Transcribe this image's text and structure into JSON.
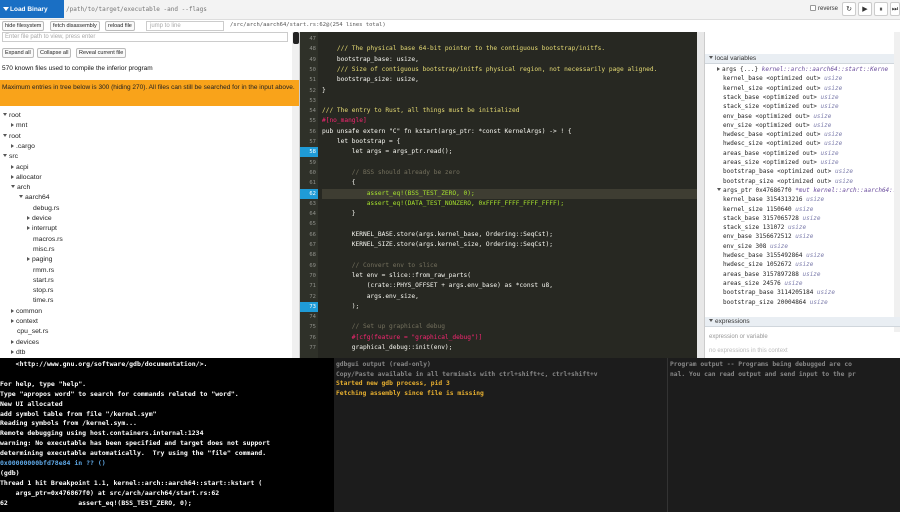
{
  "toolbar": {
    "load_label": "Load Binary",
    "binary_placeholder": "/path/to/target/executable -and --flags",
    "reverse_label": "reverse",
    "controls": [
      "↻",
      "▶",
      "⏸",
      "⏭"
    ]
  },
  "secondbar": {
    "hide_fs": "hide filesystem",
    "fetch_disasm": "fetch disassembly",
    "reload": "reload file",
    "jump_placeholder": "jump to line",
    "file_path": "/src/arch/aarch64/start.rs:62@(254 lines total)"
  },
  "left": {
    "filter_placeholder": "Enter file path to view, press enter",
    "expand_all": "Expand all",
    "collapse_all": "Collapse all",
    "reveal_current": "Reveal current file",
    "known_files": "570 known files used to compile the inferior program",
    "warning": "Maximum entries in tree below is 300 (hiding 270). All files can still be searched for in the input above.",
    "tree": [
      {
        "label": "root",
        "depth": 0,
        "icon": "down"
      },
      {
        "label": "mnt",
        "depth": 1,
        "icon": "right"
      },
      {
        "label": "root",
        "depth": 0,
        "icon": "down"
      },
      {
        "label": ".cargo",
        "depth": 1,
        "icon": "right"
      },
      {
        "label": "src",
        "depth": 0,
        "icon": "down"
      },
      {
        "label": "acpi",
        "depth": 1,
        "icon": "right"
      },
      {
        "label": "allocator",
        "depth": 1,
        "icon": "right"
      },
      {
        "label": "arch",
        "depth": 1,
        "icon": "down"
      },
      {
        "label": "aarch64",
        "depth": 2,
        "icon": "down"
      },
      {
        "label": "debug.rs",
        "depth": 3,
        "icon": ""
      },
      {
        "label": "device",
        "depth": 3,
        "icon": "right"
      },
      {
        "label": "interrupt",
        "depth": 3,
        "icon": "right"
      },
      {
        "label": "macros.rs",
        "depth": 3,
        "icon": ""
      },
      {
        "label": "misc.rs",
        "depth": 3,
        "icon": ""
      },
      {
        "label": "paging",
        "depth": 3,
        "icon": "right"
      },
      {
        "label": "rmm.rs",
        "depth": 3,
        "icon": ""
      },
      {
        "label": "start.rs",
        "depth": 3,
        "icon": ""
      },
      {
        "label": "stop.rs",
        "depth": 3,
        "icon": ""
      },
      {
        "label": "time.rs",
        "depth": 3,
        "icon": ""
      },
      {
        "label": "common",
        "depth": 1,
        "icon": "right"
      },
      {
        "label": "context",
        "depth": 1,
        "icon": "right"
      },
      {
        "label": "cpu_set.rs",
        "depth": 1,
        "icon": ""
      },
      {
        "label": "devices",
        "depth": 1,
        "icon": "right"
      },
      {
        "label": "dtb",
        "depth": 1,
        "icon": "right"
      }
    ]
  },
  "editor": {
    "lines": [
      {
        "n": "47",
        "t": ""
      },
      {
        "n": "48",
        "t": "    /// The physical base 64-bit pointer to the contiguous bootstrap/initfs.",
        "c": "#e6db74"
      },
      {
        "n": "49",
        "t": "    bootstrap_base: usize,"
      },
      {
        "n": "50",
        "t": "    /// Size of contiguous bootstrap/initfs physical region, not necessarily page aligned.",
        "c": "#e6db74"
      },
      {
        "n": "51",
        "t": "    bootstrap_size: usize,"
      },
      {
        "n": "52",
        "t": "}"
      },
      {
        "n": "53",
        "t": ""
      },
      {
        "n": "54",
        "t": "/// The entry to Rust, all things must be initialized",
        "c": "#e6db74"
      },
      {
        "n": "55",
        "t": "#[no_mangle]",
        "c": "#f92672"
      },
      {
        "n": "56",
        "t": "pub unsafe extern \"C\" fn kstart(args_ptr: *const KernelArgs) -> ! {"
      },
      {
        "n": "57",
        "t": "    let bootstrap = {"
      },
      {
        "n": "58",
        "t": "        let args = args_ptr.read();",
        "bp": true
      },
      {
        "n": "59",
        "t": ""
      },
      {
        "n": "60",
        "t": "        // BSS should already be zero",
        "c": "#75715e"
      },
      {
        "n": "61",
        "t": "        {"
      },
      {
        "n": "62",
        "t": "            assert_eq!(BSS_TEST_ZERO, 0);",
        "bp": true,
        "cur": true,
        "c": "#a6e22e"
      },
      {
        "n": "63",
        "t": "            assert_eq!(DATA_TEST_NONZERO, 0xFFFF_FFFF_FFFF_FFFF);",
        "c": "#a6e22e"
      },
      {
        "n": "64",
        "t": "        }"
      },
      {
        "n": "65",
        "t": ""
      },
      {
        "n": "66",
        "t": "        KERNEL_BASE.store(args.kernel_base, Ordering::SeqCst);"
      },
      {
        "n": "67",
        "t": "        KERNEL_SIZE.store(args.kernel_size, Ordering::SeqCst);"
      },
      {
        "n": "68",
        "t": ""
      },
      {
        "n": "69",
        "t": "        // Convert env to slice",
        "c": "#75715e"
      },
      {
        "n": "70",
        "t": "        let env = slice::from_raw_parts("
      },
      {
        "n": "71",
        "t": "            (crate::PHYS_OFFSET + args.env_base) as *const u8,"
      },
      {
        "n": "72",
        "t": "            args.env_size,"
      },
      {
        "n": "73",
        "t": "        );",
        "bp": true
      },
      {
        "n": "74",
        "t": ""
      },
      {
        "n": "75",
        "t": "        // Set up graphical debug",
        "c": "#75715e"
      },
      {
        "n": "76",
        "t": "        #[cfg(feature = \"graphical_debug\")]",
        "c": "#f92672"
      },
      {
        "n": "77",
        "t": "        graphical_debug::init(env);"
      }
    ]
  },
  "right": {
    "locals_title": "local variables",
    "locals": [
      {
        "name": "args {...}",
        "value": " kernel::arch::aarch64::start::Kerne",
        "kind": "fn",
        "tri": "right"
      },
      {
        "name": "kernel_base <optimized out>",
        "value": " usize",
        "kind": "ty"
      },
      {
        "name": "kernel_size <optimized out>",
        "value": " usize",
        "kind": "ty"
      },
      {
        "name": "stack_base <optimized out>",
        "value": " usize",
        "kind": "ty"
      },
      {
        "name": "stack_size <optimized out>",
        "value": " usize",
        "kind": "ty"
      },
      {
        "name": "env_base <optimized out>",
        "value": " usize",
        "kind": "ty"
      },
      {
        "name": "env_size <optimized out>",
        "value": " usize",
        "kind": "ty"
      },
      {
        "name": "hwdesc_base <optimized out>",
        "value": " usize",
        "kind": "ty"
      },
      {
        "name": "hwdesc_size <optimized out>",
        "value": " usize",
        "kind": "ty"
      },
      {
        "name": "areas_base <optimized out>",
        "value": " usize",
        "kind": "ty"
      },
      {
        "name": "areas_size <optimized out>",
        "value": " usize",
        "kind": "ty"
      },
      {
        "name": "bootstrap_base <optimized out>",
        "value": " usize",
        "kind": "ty"
      },
      {
        "name": "bootstrap_size <optimized out>",
        "value": " usize",
        "kind": "ty"
      },
      {
        "name": "args_ptr 0x476867f0",
        "value": " *mut kernel::arch::aarch64::s",
        "kind": "fn",
        "tri": "down"
      },
      {
        "name": "kernel_base 3154313216",
        "value": " usize",
        "kind": "ty"
      },
      {
        "name": "kernel_size 1150640",
        "value": " usize",
        "kind": "ty"
      },
      {
        "name": "stack_base 3157065728",
        "value": " usize",
        "kind": "ty"
      },
      {
        "name": "stack_size 131072",
        "value": " usize",
        "kind": "ty"
      },
      {
        "name": "env_base 3156672512",
        "value": " usize",
        "kind": "ty"
      },
      {
        "name": "env_size 308",
        "value": " usize",
        "kind": "ty"
      },
      {
        "name": "hwdesc_base 3155492864",
        "value": " usize",
        "kind": "ty"
      },
      {
        "name": "hwdesc_size 1052672",
        "value": " usize",
        "kind": "ty"
      },
      {
        "name": "areas_base 3157897288",
        "value": " usize",
        "kind": "ty"
      },
      {
        "name": "areas_size 24576",
        "value": " usize",
        "kind": "ty"
      },
      {
        "name": "bootstrap_base 3114205184",
        "value": " usize",
        "kind": "ty"
      },
      {
        "name": "bootstrap_size 20004864",
        "value": " usize",
        "kind": "ty"
      }
    ],
    "expressions_title": "expressions",
    "expr_placeholder": "expression or variable",
    "no_expr": "no expressions in this context"
  },
  "gdb": {
    "lines": [
      {
        "t": "    <http://www.gnu.org/software/gdb/documentation/>.",
        "c": "#fff"
      },
      {
        "t": "",
        "c": "#fff"
      },
      {
        "t": "For help, type \"help\".",
        "c": "#fff"
      },
      {
        "t": "Type \"apropos word\" to search for commands related to \"word\".",
        "c": "#fff"
      },
      {
        "t": "New UI allocated",
        "c": "#fff"
      },
      {
        "t": "add symbol table from file \"/kernel.sym\"",
        "c": "#fff"
      },
      {
        "t": "Reading symbols from /kernel.sym...",
        "c": "#fff"
      },
      {
        "t": "Remote debugging using host.containers.internal:1234",
        "c": "#fff"
      },
      {
        "t": "warning: No executable has been specified and target does not support",
        "c": "#fff"
      },
      {
        "t": "determining executable automatically.  Try using the \"file\" command.",
        "c": "#fff"
      },
      {
        "t": "0x00000000bfd78e84 in ?? ()",
        "c": "#5fa8e6"
      },
      {
        "t": "(gdb)",
        "c": "#fff"
      },
      {
        "t": "Thread 1 hit Breakpoint 1.1, kernel::arch::aarch64::start::kstart (",
        "c": "#fff"
      },
      {
        "t": "    args_ptr=0x476867f0) at src/arch/aarch64/start.rs:62",
        "c": "#fff"
      },
      {
        "t": "62                  assert_eq!(BSS_TEST_ZERO, 0);",
        "c": "#fff"
      }
    ]
  },
  "gdbgui_output": {
    "lines": [
      {
        "t": "gdbgui output (read-only)",
        "c": "#888"
      },
      {
        "t": "Copy/Paste available in all terminals with ctrl+shift+c, ctrl+shift+v",
        "c": "#888"
      },
      {
        "t": "Started new gdb process, pid 3",
        "c": "#e8b030"
      },
      {
        "t": "Fetching assembly since file is missing",
        "c": "#e8b030"
      }
    ]
  },
  "program_output": {
    "lines": [
      {
        "t": "Program output -- Programs being debugged are co",
        "c": "#888"
      },
      {
        "t": "nal. You can read output and send input to the pr",
        "c": "#888"
      }
    ]
  }
}
